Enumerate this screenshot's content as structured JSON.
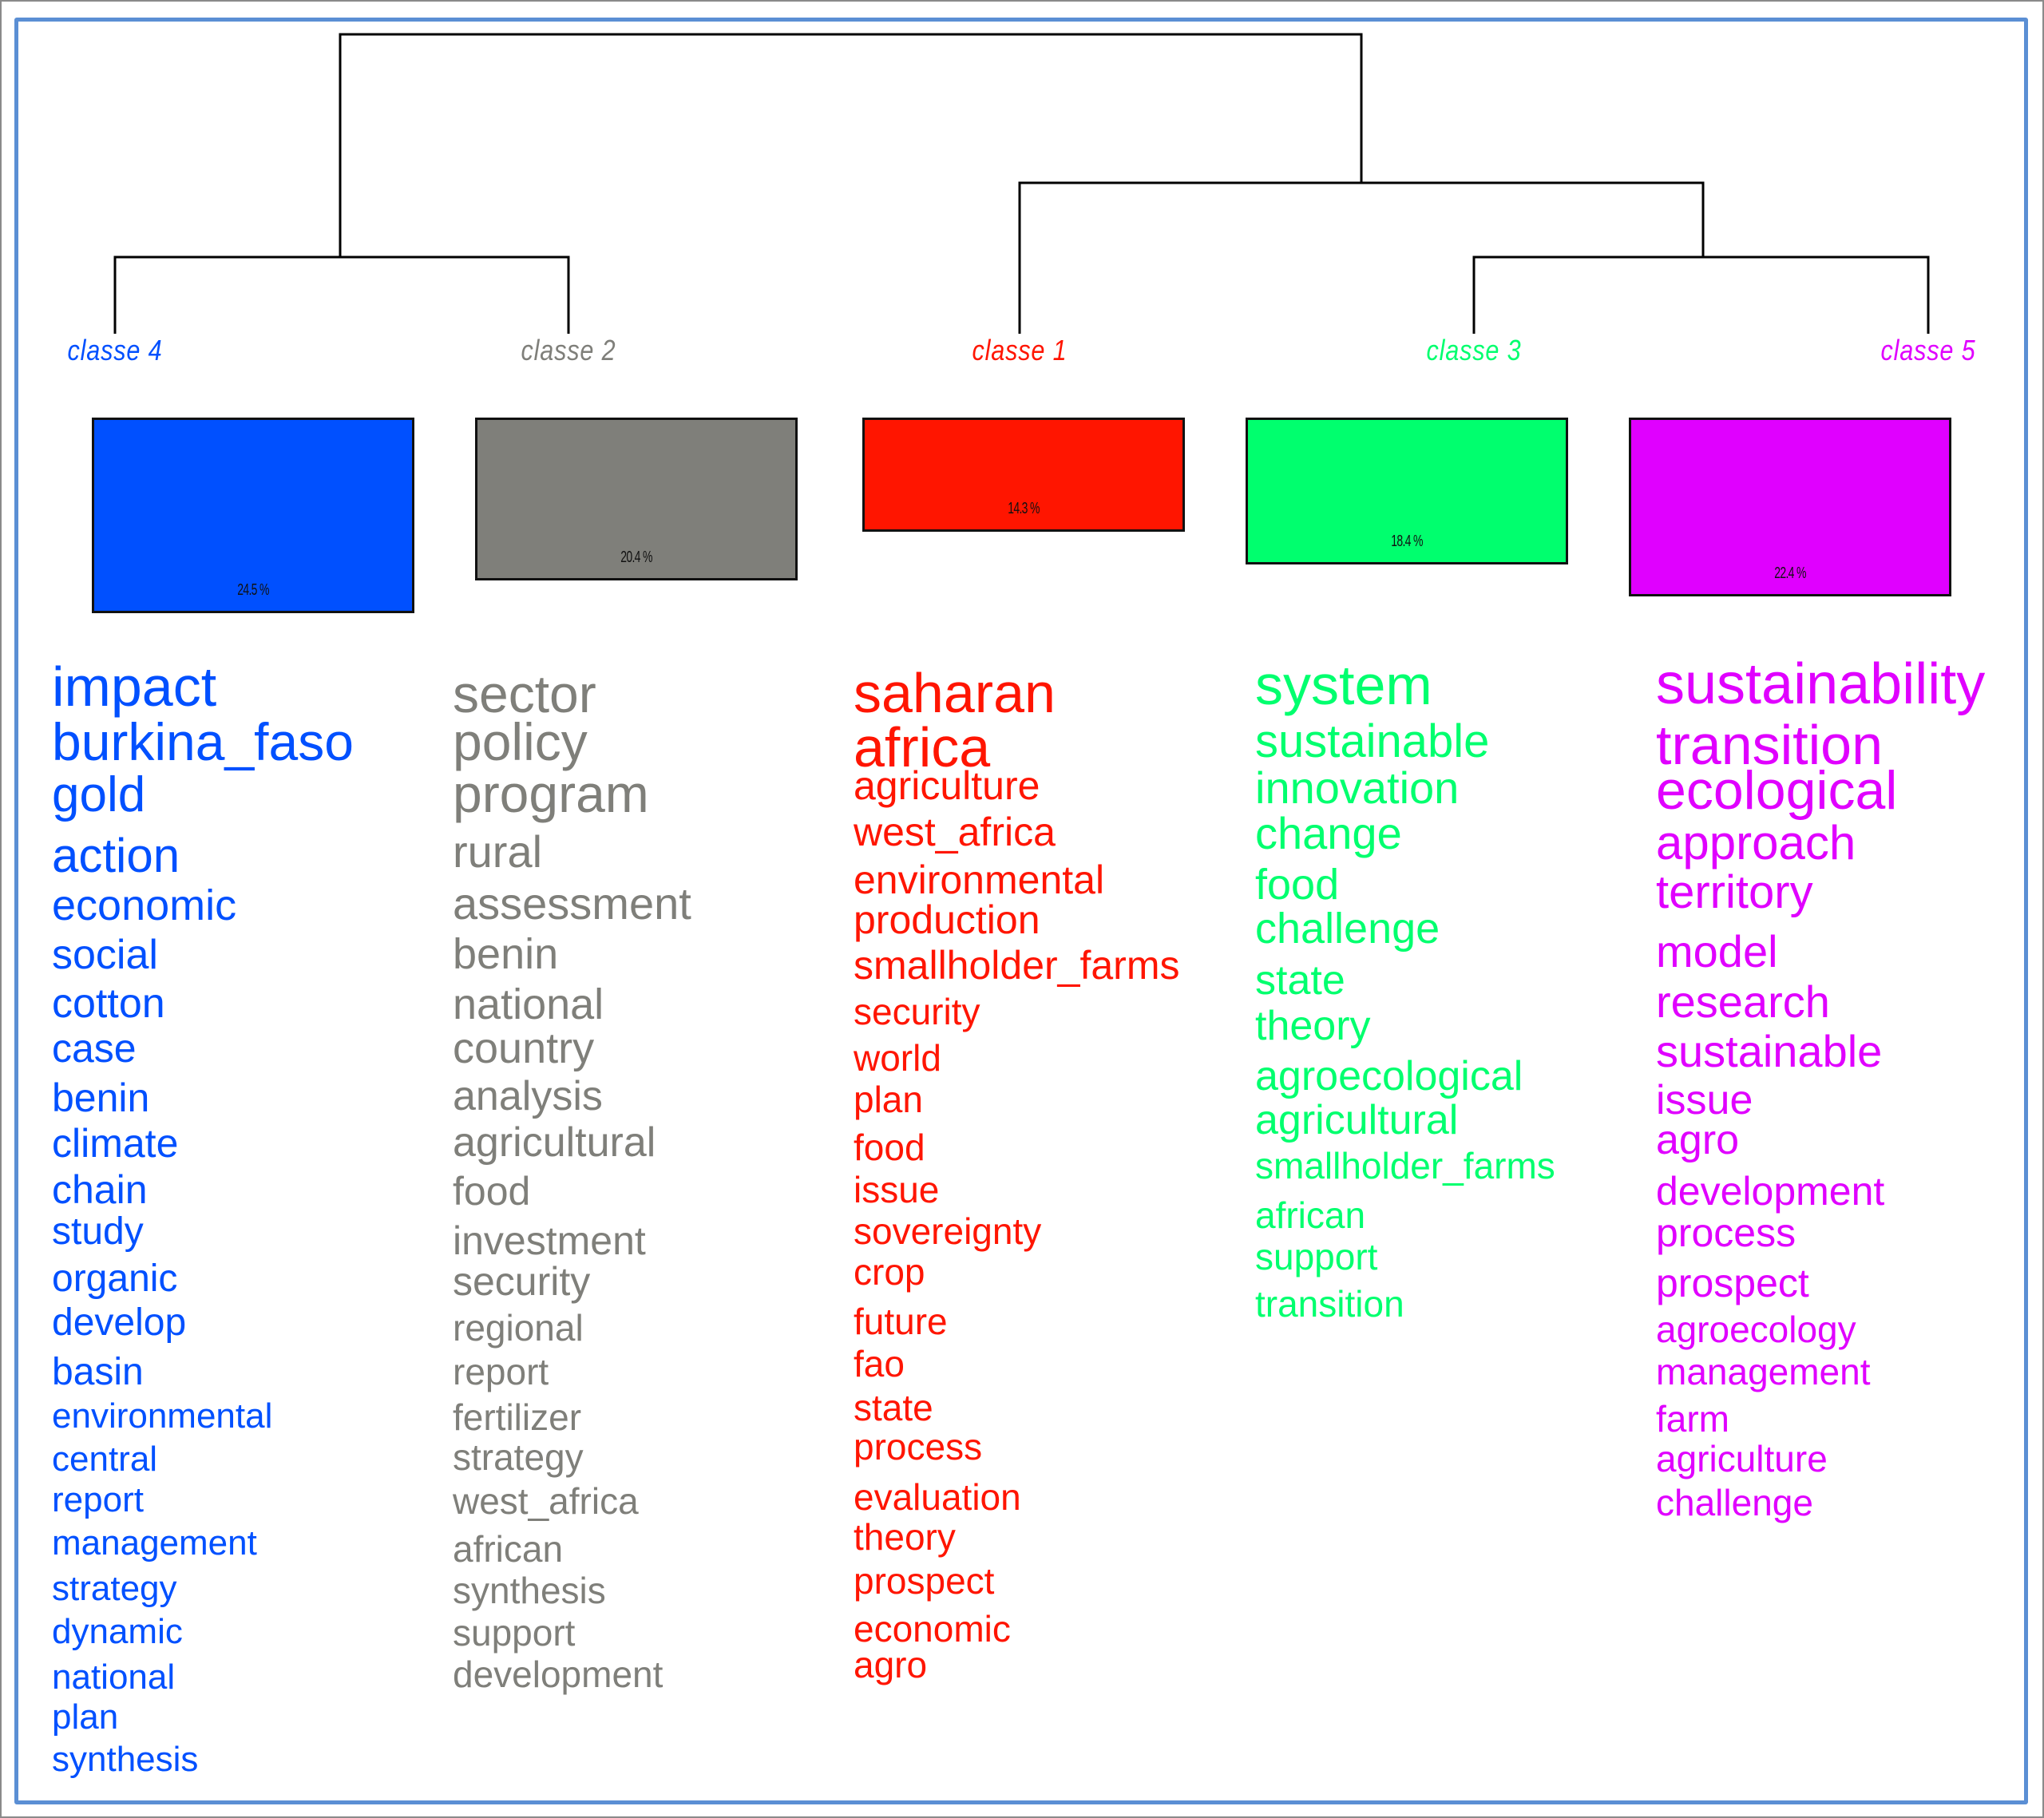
{
  "frame": {
    "outer_border_color": "#8a8a8a",
    "inner_border_color": "#5b8fd4"
  },
  "dendrogram": {
    "merges": [
      {
        "left": "classe 4",
        "right": "classe 2"
      },
      {
        "left": "classe 3",
        "right": "classe 5"
      },
      {
        "left": "classe 1",
        "right": "(classe 3, classe 5)"
      },
      {
        "left": "(classe 4, classe 2)",
        "right": "(classe 1, (classe 3, classe 5))"
      }
    ],
    "leaf_order": [
      "classe 4",
      "classe 2",
      "classe 1",
      "classe 3",
      "classe 5"
    ]
  },
  "classes": [
    {
      "id": 4,
      "label": "classe  4",
      "color": "#0050ff",
      "percent": 24.5,
      "percent_label": "24.5 %",
      "words": [
        "impact",
        "burkina_faso",
        "gold",
        "action",
        "economic",
        "social",
        "cotton",
        "case",
        "benin",
        "climate",
        "chain",
        "study",
        "organic",
        "develop",
        "basin",
        "environmental",
        "central",
        "report",
        "management",
        "strategy",
        "dynamic",
        "national",
        "plan",
        "synthesis"
      ]
    },
    {
      "id": 2,
      "label": "classe  2",
      "color": "#7f7f7a",
      "percent": 20.4,
      "percent_label": "20.4 %",
      "words": [
        "sector",
        "policy",
        "program",
        "rural",
        "assessment",
        "benin",
        "national",
        "country",
        "analysis",
        "agricultural",
        "food",
        "investment",
        "security",
        "regional",
        "report",
        "fertilizer",
        "strategy",
        "west_africa",
        "african",
        "synthesis",
        "support",
        "development"
      ]
    },
    {
      "id": 1,
      "label": "classe  1",
      "color": "#ff1500",
      "percent": 14.3,
      "percent_label": "14.3 %",
      "words": [
        "saharan",
        "africa",
        "agriculture",
        "west_africa",
        "environmental",
        "production",
        "smallholder_farms",
        "security",
        "world",
        "plan",
        "food",
        "issue",
        "sovereignty",
        "crop",
        "future",
        "fao",
        "state",
        "process",
        "evaluation",
        "theory",
        "prospect",
        "economic",
        "agro"
      ]
    },
    {
      "id": 3,
      "label": "classe  3",
      "color": "#00ff6e",
      "percent": 18.4,
      "percent_label": "18.4 %",
      "words": [
        "system",
        "sustainable",
        "innovation",
        "change",
        "food",
        "challenge",
        "state",
        "theory",
        "agroecological",
        "agricultural",
        "smallholder_farms",
        "african",
        "support",
        "transition"
      ]
    },
    {
      "id": 5,
      "label": "classe  5",
      "color": "#e000ff",
      "percent": 22.4,
      "percent_label": "22.4 %",
      "words": [
        "sustainability",
        "transition",
        "ecological",
        "approach",
        "territory",
        "model",
        "research",
        "sustainable",
        "issue",
        "agro",
        "development",
        "process",
        "prospect",
        "agroecology",
        "management",
        "farm",
        "agriculture",
        "challenge"
      ]
    }
  ]
}
